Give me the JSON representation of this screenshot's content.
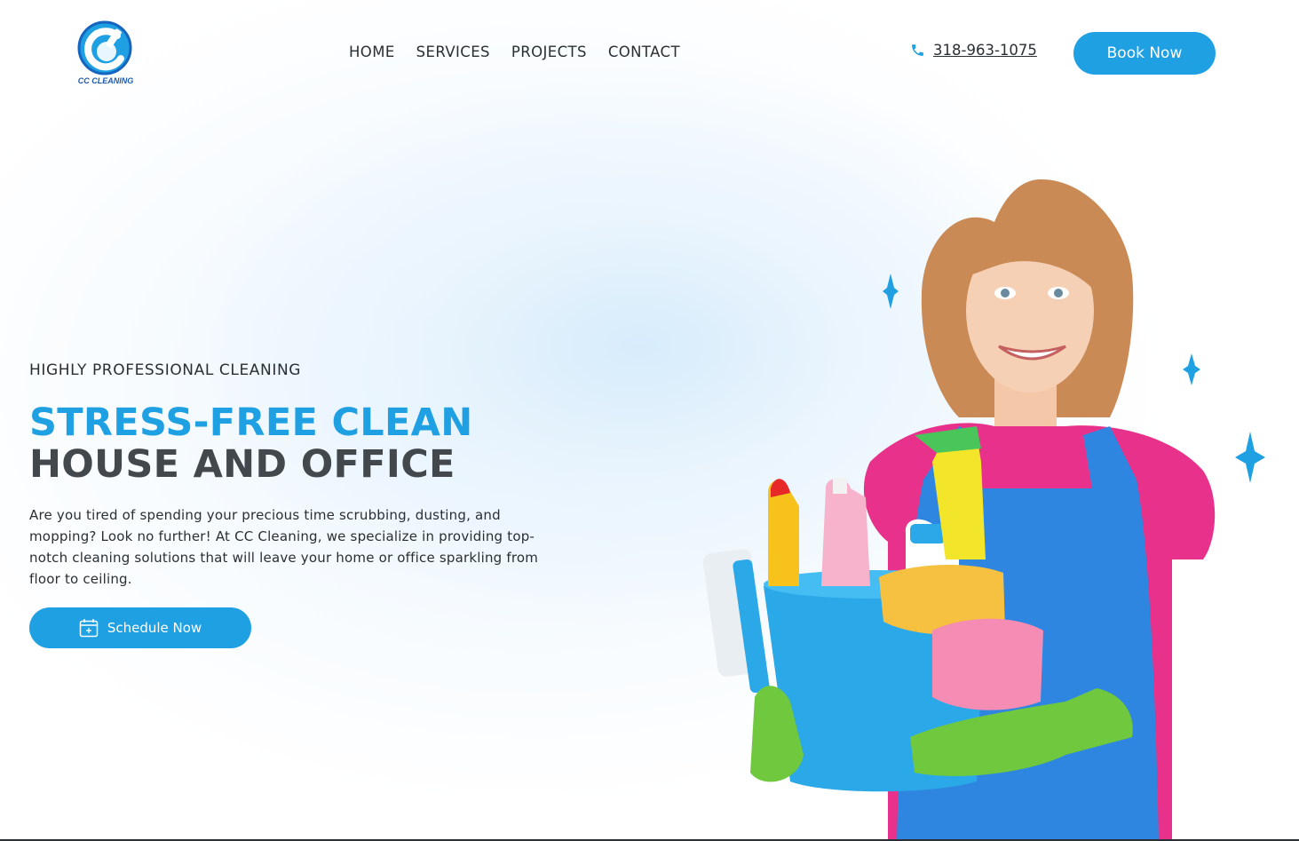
{
  "brand": {
    "logo_text": "CC CLEANING",
    "accent_color": "#1ea0e3",
    "dark_text_color": "#43484d"
  },
  "nav": {
    "items": [
      {
        "label": "HOME"
      },
      {
        "label": "SERVICES"
      },
      {
        "label": "PROJECTS"
      },
      {
        "label": "CONTACT"
      }
    ]
  },
  "header": {
    "phone_icon": "phone-icon",
    "phone": "318-963-1075",
    "book_label": "Book Now"
  },
  "hero": {
    "eyebrow": "HIGHLY PROFESSIONAL CLEANING",
    "headline_line1": "STRESS-FREE CLEAN",
    "headline_line2": "HOUSE AND OFFICE",
    "description": "Are you tired of spending your precious time scrubbing, dusting, and mopping? Look no further! At CC Cleaning, we specialize in providing top-notch cleaning solutions that will leave your home or office sparkling from floor to ceiling.",
    "cta_icon": "calendar-plus-icon",
    "cta_label": "Schedule Now"
  }
}
